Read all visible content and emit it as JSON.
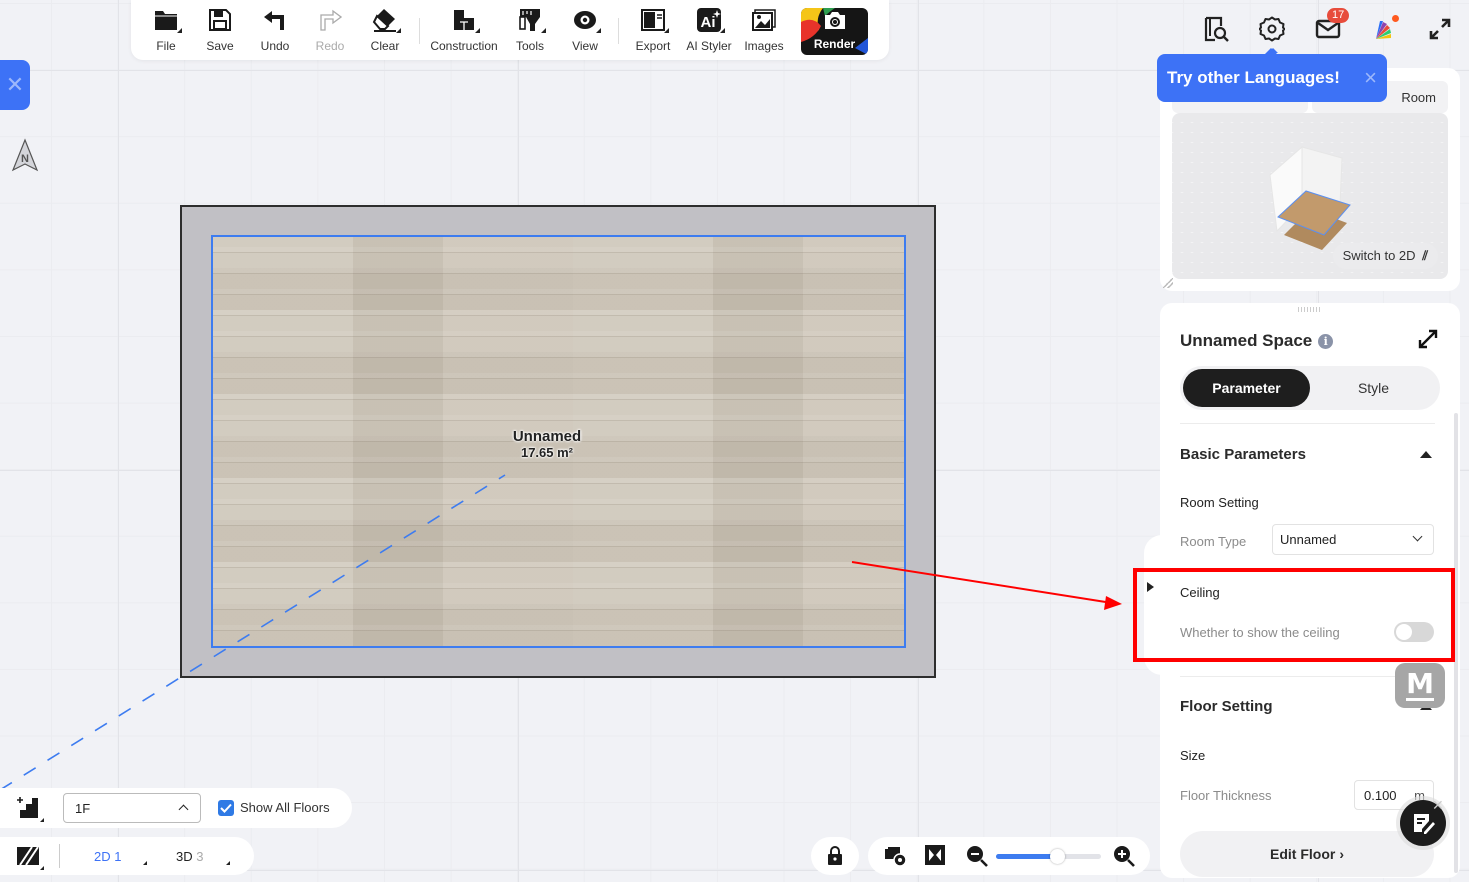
{
  "toolbar": {
    "items": [
      {
        "label": "File",
        "icon": "folder-icon",
        "has_menu": true
      },
      {
        "label": "Save",
        "icon": "floppy-disk-icon",
        "has_menu": false
      },
      {
        "label": "Undo",
        "icon": "undo-icon",
        "has_menu": false
      },
      {
        "label": "Redo",
        "icon": "redo-icon",
        "has_menu": false,
        "disabled": true
      },
      {
        "label": "Clear",
        "icon": "eraser-icon",
        "has_menu": true
      },
      {
        "label": "Construction",
        "icon": "construction-icon",
        "has_menu": true
      },
      {
        "label": "Tools",
        "icon": "tools-icon",
        "has_menu": true
      },
      {
        "label": "View",
        "icon": "eye-icon",
        "has_menu": true
      },
      {
        "label": "Export",
        "icon": "export-icon",
        "has_menu": true
      },
      {
        "label": "AI Styler",
        "icon": "ai-styler-icon",
        "has_menu": true
      },
      {
        "label": "Images",
        "icon": "images-icon",
        "has_menu": false
      }
    ],
    "render_label": "Render"
  },
  "top_right": {
    "mail_badge": "17",
    "icons": [
      "catalog-search-icon",
      "settings-gear-icon",
      "mail-icon",
      "color-palette-icon",
      "fullscreen-icon"
    ]
  },
  "language_tip": {
    "text": "Try other Languages!",
    "close": "×"
  },
  "preview": {
    "tab_right_partial": "Room",
    "switch_label": "Switch to 2D"
  },
  "canvas": {
    "compass_label": "N",
    "room_name": "Unnamed",
    "room_area": "17.65 m²"
  },
  "properties": {
    "title": "Unnamed Space",
    "tabs": [
      {
        "label": "Parameter",
        "active": true
      },
      {
        "label": "Style",
        "active": false
      }
    ],
    "basic_parameters": {
      "title": "Basic Parameters",
      "room_setting_label": "Room Setting",
      "room_type_label": "Room Type",
      "room_type_value": "Unnamed"
    },
    "ceiling": {
      "title": "Ceiling",
      "show_label": "Whether to show the ceiling",
      "show_enabled": false
    },
    "floor_setting": {
      "title": "Floor Setting",
      "size_label": "Size",
      "thickness_label": "Floor Thickness",
      "thickness_value": "0.100",
      "thickness_unit": "m",
      "edit_button": "Edit Floor"
    }
  },
  "floors": {
    "selected": "1F",
    "show_all_label": "Show All Floors",
    "show_all_checked": true
  },
  "views": {
    "view2d_label": "2D",
    "view2d_count": "1",
    "view3d_label": "3D",
    "view3d_count": "3"
  },
  "zoom": {
    "level_fraction": 0.58
  },
  "floating": {
    "m_label": "M"
  }
}
